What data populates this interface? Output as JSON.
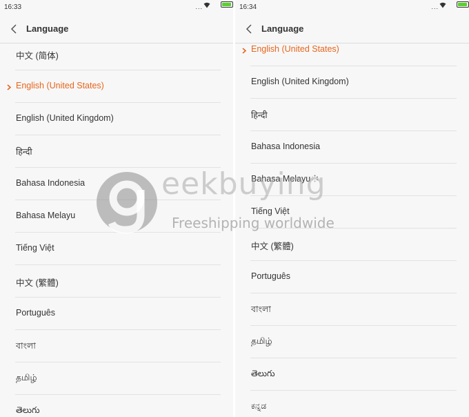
{
  "colors": {
    "accent": "#e8651c",
    "battery": "#5bd12e"
  },
  "left_screen": {
    "status_time": "16:33",
    "status_dots": "...",
    "header_title": "Language",
    "items": [
      {
        "label": "中文 (简体)",
        "selected": false
      },
      {
        "label": "English (United States)",
        "selected": true
      },
      {
        "label": "English (United Kingdom)",
        "selected": false
      },
      {
        "label": "हिन्दी",
        "selected": false
      },
      {
        "label": "Bahasa Indonesia",
        "selected": false
      },
      {
        "label": "Bahasa Melayu",
        "selected": false
      },
      {
        "label": "Tiếng Việt",
        "selected": false
      },
      {
        "label": "中文 (繁體)",
        "selected": false
      },
      {
        "label": "Português",
        "selected": false
      },
      {
        "label": "বাংলা",
        "selected": false
      },
      {
        "label": "தமிழ்",
        "selected": false
      },
      {
        "label": "తెలుగు",
        "selected": false
      }
    ]
  },
  "right_screen": {
    "status_time": "16:34",
    "status_dots": "...",
    "header_title": "Language",
    "items": [
      {
        "label": "English (United States)",
        "selected": true
      },
      {
        "label": "English (United Kingdom)",
        "selected": false
      },
      {
        "label": "हिन्दी",
        "selected": false
      },
      {
        "label": "Bahasa Indonesia",
        "selected": false
      },
      {
        "label": "Bahasa Melayu",
        "selected": false
      },
      {
        "label": "Tiếng Việt",
        "selected": false
      },
      {
        "label": "中文 (繁體)",
        "selected": false
      },
      {
        "label": "Português",
        "selected": false
      },
      {
        "label": "বাংলা",
        "selected": false
      },
      {
        "label": "தமிழ்",
        "selected": false
      },
      {
        "label": "తెలుగు",
        "selected": false
      },
      {
        "label": "ಕನ್ನಡ",
        "selected": false
      }
    ]
  },
  "watermark": {
    "brand": "eekbuying",
    "tagline": "Freeshipping worldwide"
  }
}
